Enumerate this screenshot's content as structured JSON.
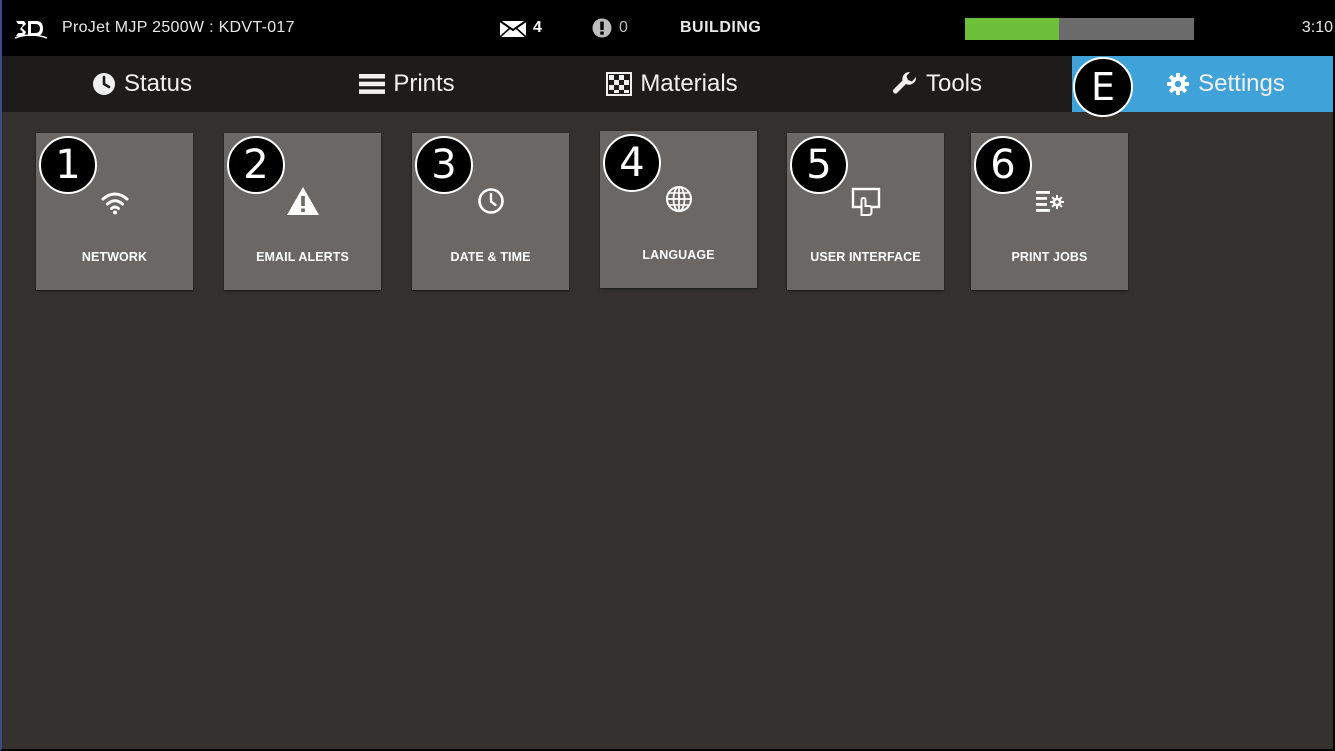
{
  "status_bar": {
    "printer_name": "ProJet MJP 2500W : KDVT-017",
    "message_count": "4",
    "alert_count": "0",
    "build_state": "BUILDING",
    "build_progress_fraction": 0.41,
    "clock": "3:10",
    "progress_color": "#6ec03a",
    "icons": {
      "logo": "3d-systems-logo",
      "messages": "envelope-icon",
      "alerts": "exclamation-icon"
    }
  },
  "tabs": [
    {
      "label": "Status",
      "icon": "clock-icon",
      "active": false
    },
    {
      "label": "Prints",
      "icon": "list-icon",
      "active": false
    },
    {
      "label": "Materials",
      "icon": "checker-icon",
      "active": false
    },
    {
      "label": "Tools",
      "icon": "wrench-icon",
      "active": false
    },
    {
      "label": "Settings",
      "icon": "gear-icon",
      "active": true,
      "callout": "E"
    }
  ],
  "active_tab_color": "#3fa2d9",
  "tiles": [
    {
      "label": "NETWORK",
      "icon": "wifi-icon",
      "callout": "1"
    },
    {
      "label": "EMAIL ALERTS",
      "icon": "warning-icon",
      "callout": "2"
    },
    {
      "label": "DATE & TIME",
      "icon": "clock-icon",
      "callout": "3"
    },
    {
      "label": "LANGUAGE",
      "icon": "globe-icon",
      "callout": "4"
    },
    {
      "label": "USER INTERFACE",
      "icon": "touch-screen-icon",
      "callout": "5"
    },
    {
      "label": "PRINT JOBS",
      "icon": "job-settings-icon",
      "callout": "6"
    }
  ]
}
